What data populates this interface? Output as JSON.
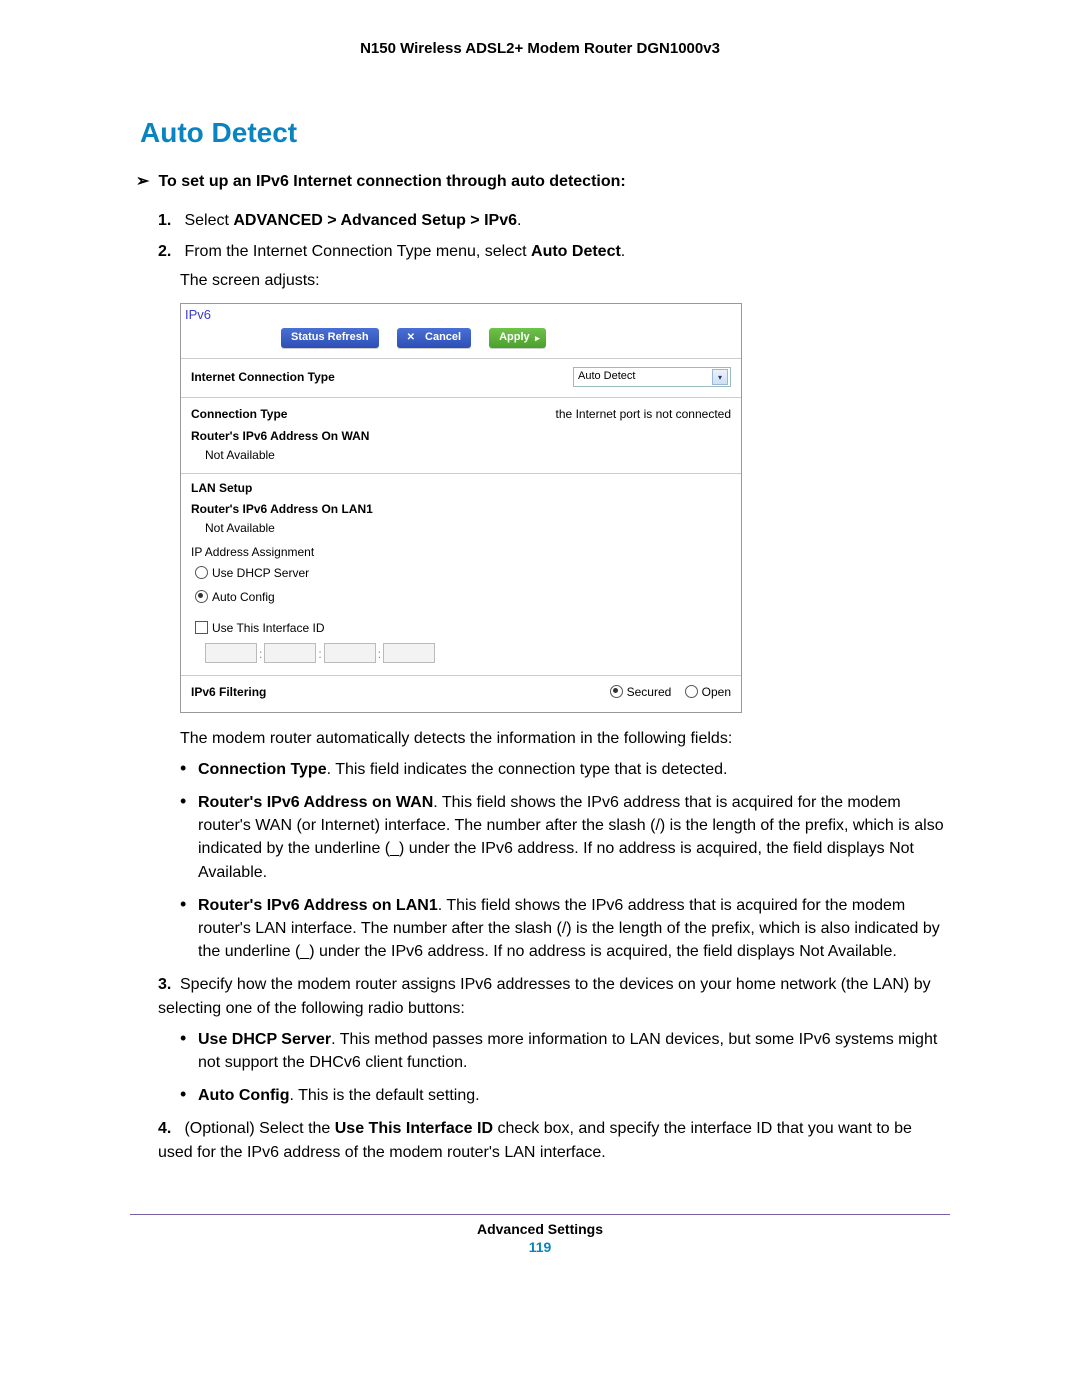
{
  "doc_header": "N150 Wireless ADSL2+ Modem Router DGN1000v3",
  "section_title": "Auto Detect",
  "task_lead": "To set up an IPv6 Internet connection through auto detection:",
  "step1_prefix": "Select ",
  "step1_bold": "ADVANCED > Advanced Setup > IPv6",
  "step1_suffix": ".",
  "step2_a": "From the Internet Connection Type menu, select ",
  "step2_bold": "Auto Detect",
  "step2_b": ".",
  "step2_sub": "The screen adjusts:",
  "after_panel": "The modem router automatically detects the information in the following fields:",
  "b_conn_type_bold": "Connection Type",
  "b_conn_type_text": ". This field indicates the connection type that is detected.",
  "b_wan_bold": "Router's IPv6 Address on WAN",
  "b_wan_text": ". This field shows the IPv6 address that is acquired for the modem router's WAN (or Internet) interface. The number after the slash (/) is the length of the prefix, which is also indicated by the underline (_) under the IPv6 address. If no address is acquired, the field displays Not Available.",
  "b_lan_bold": "Router's IPv6 Address on LAN1",
  "b_lan_text": ". This field shows the IPv6 address that is acquired for the modem router's LAN interface. The number after the slash (/) is the length of the prefix, which is also indicated by the underline (_) under the IPv6 address. If no address is acquired, the field displays Not Available.",
  "step3": "Specify how the modem router assigns IPv6 addresses to the devices on your home network (the LAN) by selecting one of the following radio buttons:",
  "b_dhcp_bold": "Use DHCP Server",
  "b_dhcp_text": ". This method passes more information to LAN devices, but some IPv6 systems might not support the DHCv6 client function.",
  "b_auto_bold": "Auto Config",
  "b_auto_text": ". This is the default setting.",
  "step4_a": "(Optional) Select the ",
  "step4_bold": "Use This Interface ID",
  "step4_b": " check box, and specify the interface ID that you want to be used for the IPv6 address of the modem router's LAN interface.",
  "ui": {
    "title": "IPv6",
    "btn_refresh": "Status Refresh",
    "btn_cancel": "Cancel",
    "btn_apply": "Apply",
    "ict_label": "Internet Connection Type",
    "ict_value": "Auto Detect",
    "conn_type_label": "Connection Type",
    "conn_type_value": "the Internet port is not connected",
    "wan_label": "Router's IPv6 Address On WAN",
    "wan_value": "Not Available",
    "lan_setup": "LAN Setup",
    "lan1_label": "Router's IPv6 Address On LAN1",
    "lan1_value": "Not Available",
    "ip_assign": "IP Address Assignment",
    "radio_dhcp": "Use DHCP Server",
    "radio_auto": "Auto Config",
    "chk_iface": "Use This Interface ID",
    "filtering_label": "IPv6 Filtering",
    "filter_secured": "Secured",
    "filter_open": "Open"
  },
  "footer_title": "Advanced Settings",
  "page_number": "119"
}
